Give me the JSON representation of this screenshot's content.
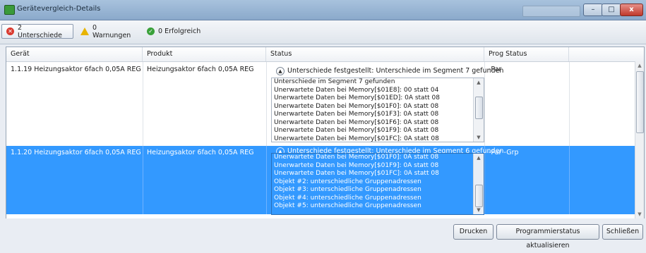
{
  "window": {
    "title": "Gerätevergleich-Details",
    "controls": {
      "minimize_glyph": "–",
      "maximize_glyph": "□",
      "close_glyph": "x"
    }
  },
  "filters": [
    {
      "label": "2 Unterschiede",
      "icon": "error-icon"
    },
    {
      "label": "0 Warnungen",
      "icon": "warning-icon"
    },
    {
      "label": "0 Erfolgreich",
      "icon": "success-icon"
    }
  ],
  "table": {
    "columns": [
      "Gerät",
      "Produkt",
      "Status",
      "Prog Status Unterschied"
    ],
    "rows": [
      {
        "geraet": "1.1.19  Heizungsaktor 6fach 0,05A REG",
        "produkt": "Heizungsaktor 6fach 0,05A REG",
        "status": "Unterschiede festgestellt: Unterschiede im Segment 7 gefunden",
        "prog_status": "-Par",
        "details": [
          "Unterschiede im Segment 7 gefunden",
          "Unerwartete Daten bei Memory[$01E8]: 00 statt 04",
          "Unerwartete Daten bei Memory[$01ED]: 0A statt 08",
          "Unerwartete Daten bei Memory[$01F0]: 0A statt 08",
          "Unerwartete Daten bei Memory[$01F3]: 0A statt 08",
          "Unerwartete Daten bei Memory[$01F6]: 0A statt 08",
          "Unerwartete Daten bei Memory[$01F9]: 0A statt 08",
          "Unerwartete Daten bei Memory[$01FC]: 0A statt 08"
        ]
      },
      {
        "geraet": "1.1.20  Heizungsaktor 6fach 0,05A REG",
        "produkt": "Heizungsaktor 6fach 0,05A REG",
        "status": "Unterschiede festgestellt: Unterschiede im Segment 6 gefunden",
        "prog_status": "-Par -Grp",
        "details": [
          "Unerwartete Daten bei Memory[$01F0]: 0A statt 08",
          "Unerwartete Daten bei Memory[$01F9]: 0A statt 08",
          "Unerwartete Daten bei Memory[$01FC]: 0A statt 08",
          "Objekt #2: unterschiedliche Gruppenadressen",
          "Objekt #3: unterschiedliche Gruppenadressen",
          "Objekt #4: unterschiedliche Gruppenadressen",
          "Objekt #5: unterschiedliche Gruppenadressen"
        ]
      }
    ]
  },
  "buttons": {
    "print": "Drucken",
    "update": "Programmierstatus aktualisieren",
    "close": "Schließen"
  },
  "colors": {
    "selection": "#3399ff",
    "titlebar": "#8aa9cb"
  }
}
